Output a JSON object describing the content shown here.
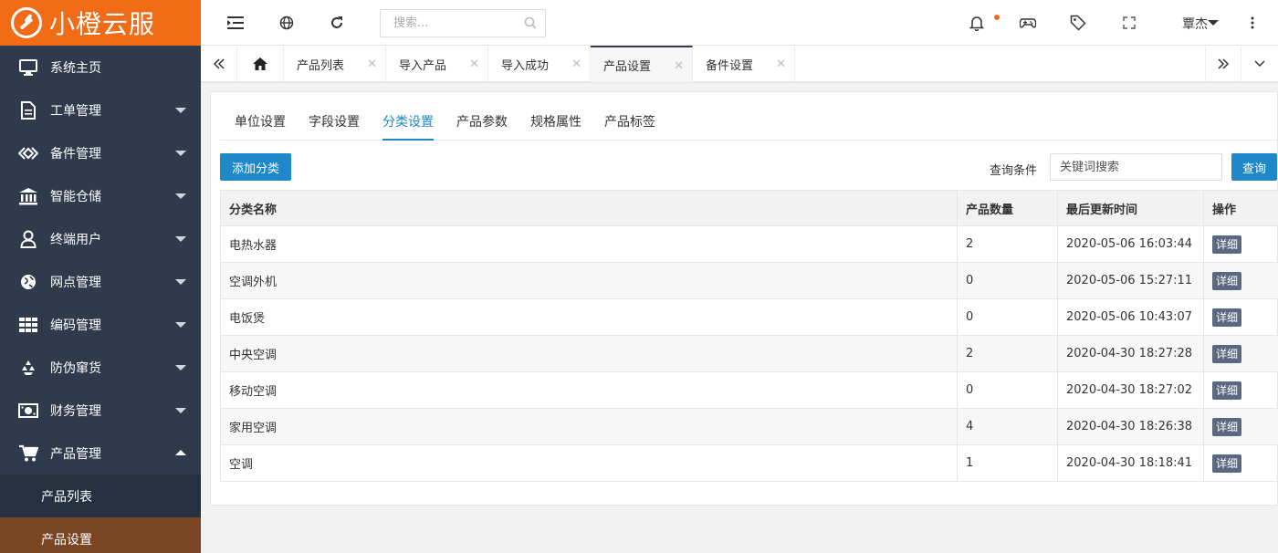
{
  "app": {
    "logo_text": "小橙云服",
    "brand_color": "#f26b16",
    "sidebar_bg": "#2f3a4c",
    "accent_color": "#1e88c9"
  },
  "sidebar": {
    "items": [
      {
        "label": "系统主页",
        "icon": "monitor-icon"
      },
      {
        "label": "工单管理",
        "icon": "document-icon"
      },
      {
        "label": "备件管理",
        "icon": "code-diamond-icon"
      },
      {
        "label": "智能仓储",
        "icon": "bank-icon"
      },
      {
        "label": "终端用户",
        "icon": "user-icon"
      },
      {
        "label": "网点管理",
        "icon": "globe-icon"
      },
      {
        "label": "编码管理",
        "icon": "grid-icon"
      },
      {
        "label": "防伪窜货",
        "icon": "recycle-icon"
      },
      {
        "label": "财务管理",
        "icon": "money-icon"
      },
      {
        "label": "产品管理",
        "icon": "cart-icon"
      }
    ],
    "submenu": [
      {
        "label": "产品列表"
      },
      {
        "label": "产品设置"
      }
    ]
  },
  "header": {
    "search_placeholder": "搜索...",
    "user_name": "覃杰"
  },
  "tabs": [
    {
      "label": "产品列表"
    },
    {
      "label": "导入产品"
    },
    {
      "label": "导入成功"
    },
    {
      "label": "产品设置"
    },
    {
      "label": "备件设置"
    }
  ],
  "subtabs": [
    {
      "label": "单位设置"
    },
    {
      "label": "字段设置"
    },
    {
      "label": "分类设置"
    },
    {
      "label": "产品参数"
    },
    {
      "label": "规格属性"
    },
    {
      "label": "产品标签"
    }
  ],
  "toolbar": {
    "add_label": "添加分类",
    "query_label": "查询条件",
    "query_placeholder": "关键词搜索",
    "query_button": "查询"
  },
  "table": {
    "columns": [
      "分类名称",
      "产品数量",
      "最后更新时间",
      "操作"
    ],
    "detail_label": "详细",
    "rows": [
      {
        "name": "电热水器",
        "count": "2",
        "updated": "2020-05-06 16:03:44"
      },
      {
        "name": "空调外机",
        "count": "0",
        "updated": "2020-05-06 15:27:11"
      },
      {
        "name": "电饭煲",
        "count": "0",
        "updated": "2020-05-06 10:43:07"
      },
      {
        "name": "中央空调",
        "count": "2",
        "updated": "2020-04-30 18:27:28"
      },
      {
        "name": "移动空调",
        "count": "0",
        "updated": "2020-04-30 18:27:02"
      },
      {
        "name": "家用空调",
        "count": "4",
        "updated": "2020-04-30 18:26:38"
      },
      {
        "name": "空调",
        "count": "1",
        "updated": "2020-04-30 18:18:41"
      }
    ]
  }
}
